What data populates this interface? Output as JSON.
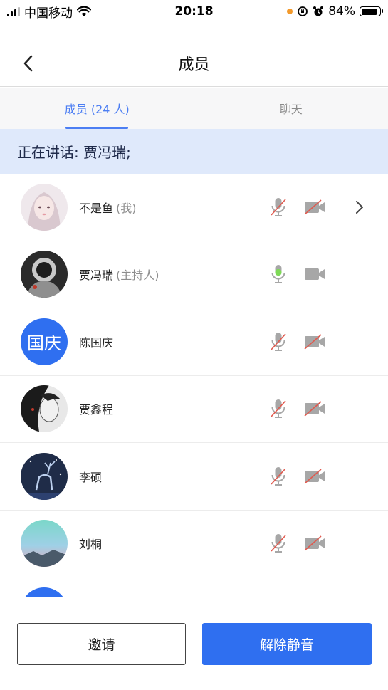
{
  "status_bar": {
    "carrier": "中国移动",
    "time": "20:18",
    "battery": "84%",
    "battery_level": 0.84,
    "icons": [
      "signal-icon",
      "wifi-icon",
      "orientation-lock-icon",
      "alarm-icon",
      "battery-icon"
    ]
  },
  "header": {
    "title": "成员",
    "back_icon": "chevron-left-icon"
  },
  "tabs": [
    {
      "label": "成员 (24 人)",
      "active": true
    },
    {
      "label": "聊天",
      "active": false
    }
  ],
  "speaking": {
    "text": "正在讲话: 贾冯瑞;"
  },
  "members": [
    {
      "name": "不是鱼",
      "role": "(我)",
      "mic": "muted",
      "camera": "off",
      "chevron": true
    },
    {
      "name": "贾冯瑞",
      "role": "(主持人)",
      "mic": "active",
      "camera": "on",
      "chevron": false
    },
    {
      "name": "陈国庆",
      "role": "",
      "avatar_text": "国庆",
      "mic": "muted",
      "camera": "off",
      "chevron": false
    },
    {
      "name": "贾鑫程",
      "role": "",
      "mic": "muted",
      "camera": "off",
      "chevron": false
    },
    {
      "name": "李硕",
      "role": "",
      "mic": "muted",
      "camera": "off",
      "chevron": false
    },
    {
      "name": "刘桐",
      "role": "",
      "mic": "muted",
      "camera": "off",
      "chevron": false
    }
  ],
  "footer": {
    "invite_label": "邀请",
    "unmute_label": "解除静音"
  },
  "colors": {
    "accent": "#2f6ff0",
    "tab_active": "#4c7ef3",
    "banner_bg": "#dfe9fb",
    "mic_active": "#7ed957",
    "muted_slash": "#e05a4f",
    "icon_gray": "#a7a7a7"
  }
}
